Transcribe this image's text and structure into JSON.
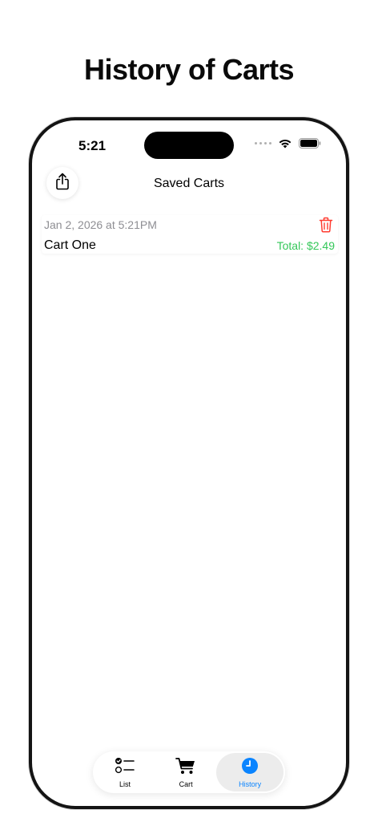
{
  "promo": {
    "title": "History of Carts"
  },
  "status_bar": {
    "time": "5:21"
  },
  "nav": {
    "title": "Saved Carts",
    "share_icon": "share-icon"
  },
  "carts": [
    {
      "date": "Jan 2, 2026 at 5:21PM",
      "name": "Cart One",
      "total": "Total: $2.49",
      "delete_icon": "trash-icon"
    }
  ],
  "tabs": [
    {
      "label": "List",
      "icon": "checklist-icon",
      "active": false
    },
    {
      "label": "Cart",
      "icon": "cart-icon",
      "active": false
    },
    {
      "label": "History",
      "icon": "clock-icon",
      "active": true
    }
  ],
  "colors": {
    "accent": "#0a84ff",
    "total_green": "#34c759",
    "delete_red": "#ff3b30",
    "secondary_text": "#8e8e93"
  }
}
